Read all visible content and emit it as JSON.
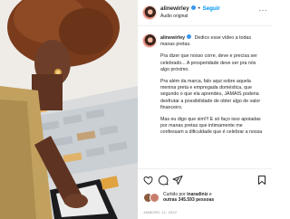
{
  "header": {
    "username": "alinewirley",
    "follow_label": "Seguir",
    "dot": "•",
    "audio_label": "Áudio original",
    "more_label": "···"
  },
  "caption": {
    "username": "alinewirley",
    "paragraphs": [
      "Dedico esse vídeo a todas manas pretas.",
      "Pra dizer que nosso corre, deve e precisa ser celebrado... A prosperidade deve ser pra nós algo próximo.",
      "Pra além da marca, falo aqui sobre aquela menina preta e empregada doméstica, que segundo o que ela aprendeu, JAMAIS poderia desfrutar a possibilidade de obter algo de valor financeiro.",
      "Mas eu digo que sim!!! E só faço isso apoiadas por manas pretas que intimamente me confessam a dificuldade que é celebrar a nossa"
    ]
  },
  "actions": {
    "icons": [
      "heart-icon",
      "comment-icon",
      "share-icon",
      "bookmark-icon"
    ]
  },
  "likes": {
    "prefix": "Curtido por",
    "user": "inaradiniz",
    "connector": "e",
    "others": "outras 345.593 pessoas"
  },
  "date": "JANEIRO 12, 2022"
}
